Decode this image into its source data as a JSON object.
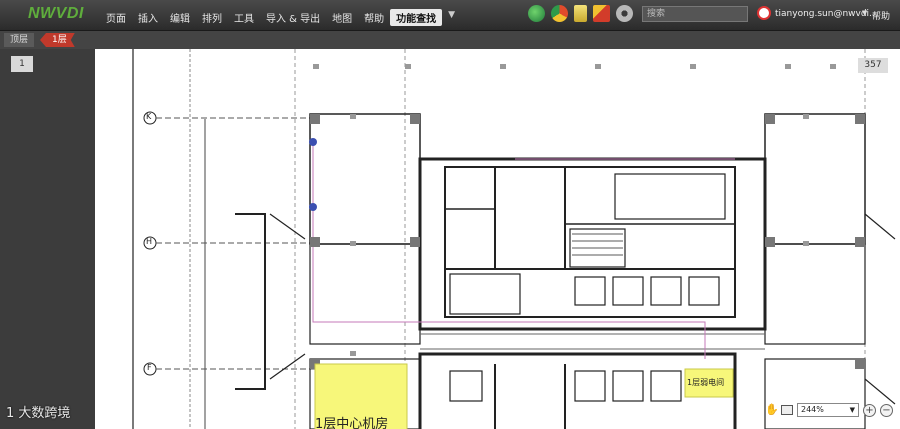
{
  "app": {
    "logo": "NWVDI"
  },
  "menu": {
    "items": [
      {
        "label": "页面"
      },
      {
        "label": "插入"
      },
      {
        "label": "编辑"
      },
      {
        "label": "排列"
      },
      {
        "label": "工具"
      },
      {
        "label": "导入 & 导出"
      },
      {
        "label": "地图"
      },
      {
        "label": "帮助"
      },
      {
        "label": "功能查找"
      }
    ],
    "more": "▼"
  },
  "toolbar_icons": [
    {
      "name": "globe-icon",
      "color": "#3aa655"
    },
    {
      "name": "chrome-icon",
      "color": "#e04b2b"
    },
    {
      "name": "document-icon",
      "color": "#e8d44d"
    },
    {
      "name": "tools-icon",
      "color": "#d23c2a"
    },
    {
      "name": "gear-icon",
      "color": "#9a9a9a"
    }
  ],
  "search": {
    "placeholder": "搜索"
  },
  "user": {
    "name": "tianyong.sun@nwvdi...",
    "help": "帮助"
  },
  "breadcrumb": {
    "top": "顶层",
    "current": "1层"
  },
  "pages": {
    "thumb": "1",
    "count": "357"
  },
  "floorplan": {
    "axis_labels": [
      "K",
      "H",
      "F"
    ],
    "big_room": "1层中心机房",
    "small_room": "1层弱电间",
    "highlight_color": "#f7f77a"
  },
  "zoom": {
    "value": "244%",
    "plus": "+",
    "minus": "−"
  },
  "watermark": "1 大数跨境"
}
